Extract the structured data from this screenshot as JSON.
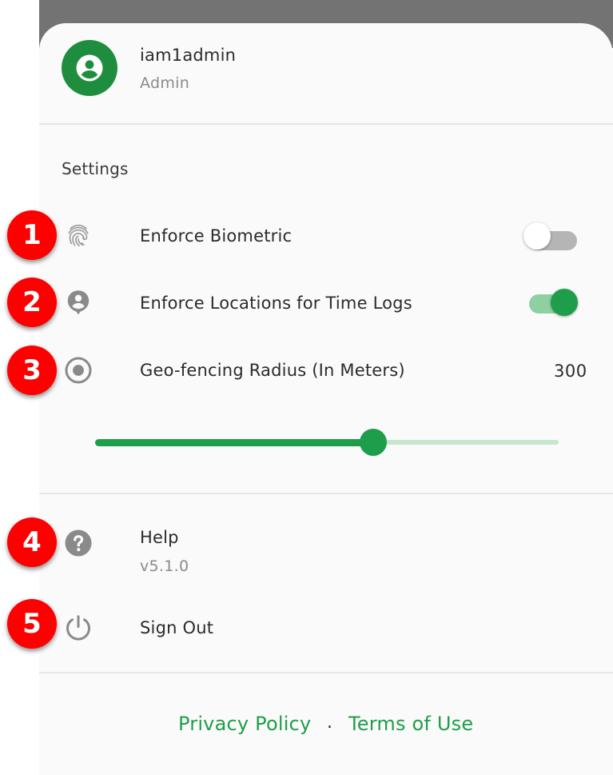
{
  "user": {
    "name": "iam1admin",
    "role": "Admin"
  },
  "settings": {
    "title": "Settings",
    "enforce_biometric": {
      "label": "Enforce Biometric",
      "enabled": false
    },
    "enforce_locations": {
      "label": "Enforce Locations for Time Logs",
      "enabled": true
    },
    "geofencing": {
      "label": "Geo-fencing Radius (In Meters)",
      "value": "300",
      "slider_fraction": 0.6
    }
  },
  "help": {
    "label": "Help",
    "version": "v5.1.0"
  },
  "sign_out": {
    "label": "Sign Out"
  },
  "footer": {
    "privacy": "Privacy Policy",
    "separator": ".",
    "terms": "Terms of Use"
  },
  "badges": [
    "1",
    "2",
    "3",
    "4",
    "5"
  ],
  "colors": {
    "accent": "#1e9e4a",
    "avatar_bg": "#1e8e3e",
    "toggle_off_track": "#b5b5b5",
    "toggle_on_track": "#8fd0a2",
    "slider_rail": "#c6e6cf",
    "badge": "#ff0000",
    "icon_gray": "#8a8a8a"
  },
  "icons": {
    "avatar": "account-circle-icon",
    "biometric": "fingerprint-icon",
    "location": "person-pin-icon",
    "geofence": "radio-target-icon",
    "help": "help-circle-icon",
    "sign_out": "power-icon"
  }
}
